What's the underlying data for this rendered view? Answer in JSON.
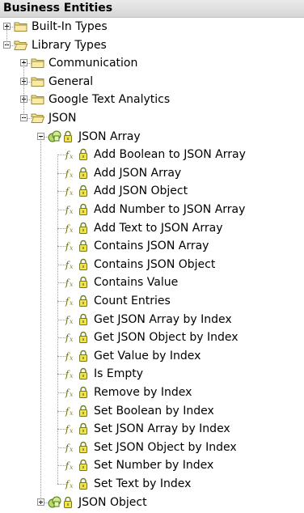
{
  "header": {
    "title": "Business Entities"
  },
  "tree": [
    {
      "id": "built-in-types",
      "label": "Built-In Types",
      "level": 0,
      "kind": "folder",
      "expander": "plus"
    },
    {
      "id": "library-types",
      "label": "Library Types",
      "level": 0,
      "kind": "folder-open",
      "expander": "minus"
    },
    {
      "id": "communication",
      "label": "Communication",
      "level": 1,
      "kind": "folder",
      "expander": "plus"
    },
    {
      "id": "general",
      "label": "General",
      "level": 1,
      "kind": "folder",
      "expander": "plus"
    },
    {
      "id": "google-text-analytics",
      "label": "Google Text Analytics",
      "level": 1,
      "kind": "folder",
      "expander": "plus"
    },
    {
      "id": "json",
      "label": "JSON",
      "level": 1,
      "kind": "folder-open",
      "expander": "minus"
    },
    {
      "id": "json-array",
      "label": "JSON Array",
      "level": 2,
      "kind": "entity",
      "expander": "minus"
    },
    {
      "id": "add-boolean-to-json-array",
      "label": "Add Boolean to JSON Array",
      "level": 3,
      "kind": "method"
    },
    {
      "id": "add-json-array",
      "label": "Add JSON Array",
      "level": 3,
      "kind": "method"
    },
    {
      "id": "add-json-object",
      "label": "Add JSON Object",
      "level": 3,
      "kind": "method"
    },
    {
      "id": "add-number-to-json-array",
      "label": "Add Number to JSON Array",
      "level": 3,
      "kind": "method"
    },
    {
      "id": "add-text-to-json-array",
      "label": "Add Text to JSON Array",
      "level": 3,
      "kind": "method"
    },
    {
      "id": "contains-json-array",
      "label": "Contains JSON Array",
      "level": 3,
      "kind": "method"
    },
    {
      "id": "contains-json-object",
      "label": "Contains JSON Object",
      "level": 3,
      "kind": "method"
    },
    {
      "id": "contains-value",
      "label": "Contains Value",
      "level": 3,
      "kind": "method"
    },
    {
      "id": "count-entries",
      "label": "Count Entries",
      "level": 3,
      "kind": "method"
    },
    {
      "id": "get-json-array-by-index",
      "label": "Get JSON Array by Index",
      "level": 3,
      "kind": "method"
    },
    {
      "id": "get-json-object-by-index",
      "label": "Get JSON Object by Index",
      "level": 3,
      "kind": "method"
    },
    {
      "id": "get-value-by-index",
      "label": "Get Value by Index",
      "level": 3,
      "kind": "method"
    },
    {
      "id": "is-empty",
      "label": "Is Empty",
      "level": 3,
      "kind": "method"
    },
    {
      "id": "remove-by-index",
      "label": "Remove by Index",
      "level": 3,
      "kind": "method"
    },
    {
      "id": "set-boolean-by-index",
      "label": "Set Boolean by Index",
      "level": 3,
      "kind": "method"
    },
    {
      "id": "set-json-array-by-index",
      "label": "Set JSON Array by Index",
      "level": 3,
      "kind": "method"
    },
    {
      "id": "set-json-object-by-index",
      "label": "Set JSON Object by Index",
      "level": 3,
      "kind": "method"
    },
    {
      "id": "set-number-by-index",
      "label": "Set Number by Index",
      "level": 3,
      "kind": "method"
    },
    {
      "id": "set-text-by-index",
      "label": "Set Text by Index",
      "level": 3,
      "kind": "method"
    },
    {
      "id": "json-object",
      "label": "JSON Object",
      "level": 2,
      "kind": "entity",
      "expander": "plus"
    }
  ],
  "colors": {
    "folder_fill": "#f5e08a",
    "folder_stroke": "#9c8a3a",
    "lock_fill": "#f3e24a",
    "lock_stroke": "#6e7a1e",
    "entity_fill": "#b8d86a",
    "entity_stroke": "#4f7a1a",
    "line_color": "#9a9a9a"
  }
}
